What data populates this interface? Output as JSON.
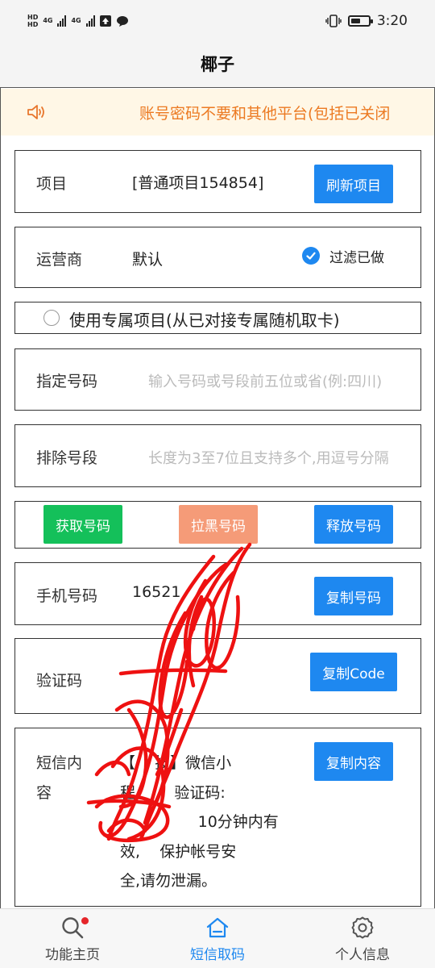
{
  "status_bar": {
    "sim1_tag": "HD",
    "sim2_tag": "HD",
    "net1": "4G",
    "net2": "4G",
    "time": "3:20",
    "icons": [
      "signal-icon",
      "upload-icon",
      "message-bubble-icon",
      "vibrate-icon",
      "battery-icon"
    ]
  },
  "header": {
    "title": "椰子"
  },
  "notice": {
    "text": "账号密码不要和其他平台(包括已关闭",
    "color": "#ec7a22"
  },
  "project": {
    "label": "项目",
    "value": "[普通项目154854]",
    "refresh_button": "刷新项目"
  },
  "carrier": {
    "label": "运营商",
    "value": "默认",
    "filter_label": "过滤已做",
    "filter_checked": true
  },
  "exclusive": {
    "label": "使用专属项目(从已对接专属随机取卡)",
    "checked": false
  },
  "specify_number": {
    "label": "指定号码",
    "placeholder": "输入号码或号段前五位或省(例:四川)"
  },
  "exclude_range": {
    "label": "排除号段",
    "placeholder": "长度为3至7位且支持多个,用逗号分隔"
  },
  "actions": {
    "get_number": "获取号码",
    "blacklist_number": "拉黑号码",
    "release_number": "释放号码"
  },
  "phone": {
    "label": "手机号码",
    "value": "16521",
    "copy_button": "复制号码"
  },
  "code": {
    "label": "验证码",
    "value": "",
    "copy_button": "复制Code"
  },
  "sms": {
    "label_line1": "短信内",
    "label_line2": "容",
    "lines": [
      "【    技】微信小",
      "程        验证码:",
      "                10分钟内有",
      "效,    保护帐号安",
      "全,请勿泄漏。"
    ],
    "copy_button": "复制内容"
  },
  "nav": {
    "items": [
      {
        "label": "功能主页",
        "icon": "search-icon",
        "badge": true,
        "active": false
      },
      {
        "label": "短信取码",
        "icon": "home-icon",
        "active": true
      },
      {
        "label": "个人信息",
        "icon": "gear-icon",
        "active": false
      }
    ]
  },
  "colors": {
    "primary": "#1e88f0",
    "success": "#14c05a",
    "warning": "#f59b78",
    "notice": "#ec7a22"
  }
}
